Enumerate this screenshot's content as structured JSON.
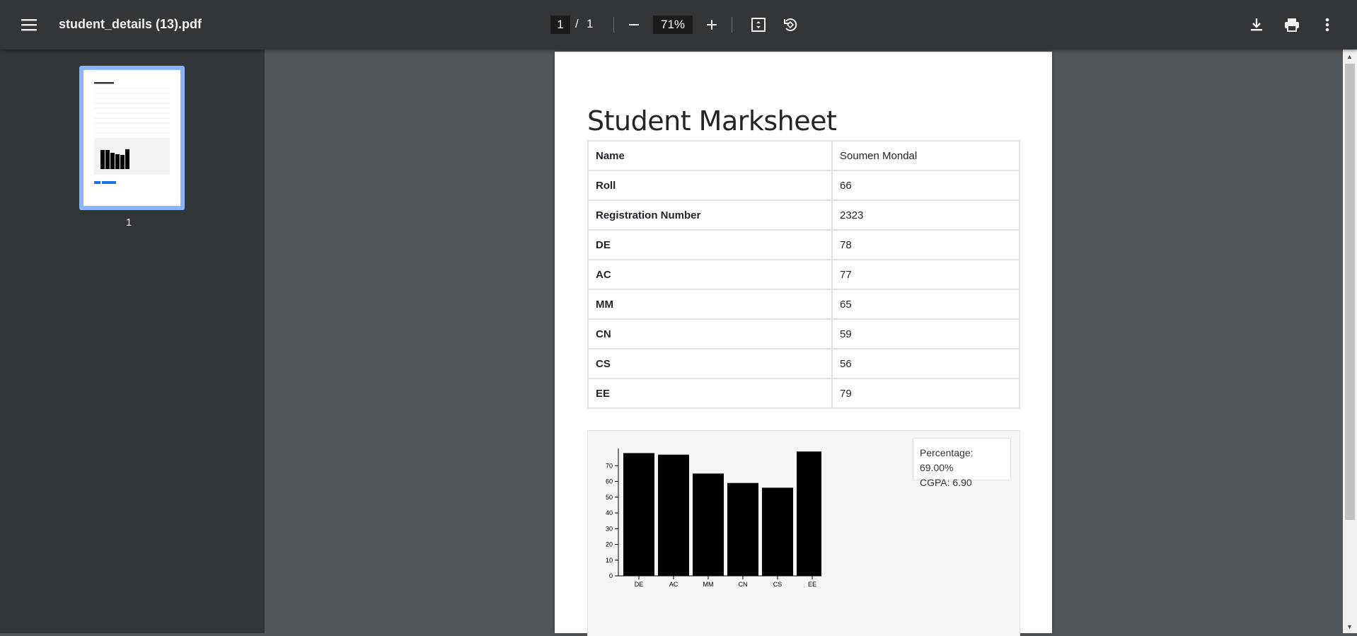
{
  "toolbar": {
    "menu_icon": "hamburger-menu-icon",
    "title": "student_details (13).pdf",
    "current_page": "1",
    "page_separator": "/",
    "total_pages": "1",
    "zoom": "71%",
    "icons": [
      "minus-icon",
      "plus-icon",
      "fit-page-icon",
      "rotate-icon",
      "download-icon",
      "print-icon",
      "more-vert-icon"
    ]
  },
  "sidebar": {
    "thumbnail_label": "1"
  },
  "document": {
    "heading": "Student Marksheet",
    "rows": [
      {
        "label": "Name",
        "value": "Soumen Mondal"
      },
      {
        "label": "Roll",
        "value": "66"
      },
      {
        "label": "Registration Number",
        "value": "2323"
      },
      {
        "label": "DE",
        "value": "78"
      },
      {
        "label": "AC",
        "value": "77"
      },
      {
        "label": "MM",
        "value": "65"
      },
      {
        "label": "CN",
        "value": "59"
      },
      {
        "label": "CS",
        "value": "56"
      },
      {
        "label": "EE",
        "value": "79"
      }
    ],
    "stats": {
      "percentage": "Percentage: 69.00%",
      "cgpa": "CGPA: 6.90"
    }
  },
  "chart_data": {
    "type": "bar",
    "categories": [
      "DE",
      "AC",
      "MM",
      "CN",
      "CS",
      "EE"
    ],
    "values": [
      78,
      77,
      65,
      59,
      56,
      79
    ],
    "yticks": [
      0,
      10,
      20,
      30,
      40,
      50,
      60,
      70
    ],
    "ylim": [
      0,
      80
    ],
    "bar_color": "#000000",
    "grid": false
  },
  "colors": {
    "toolbar_bg": "#323639",
    "viewer_bg": "#525659",
    "thumbnail_highlight": "#8ab4f8",
    "page_input_bg": "#191b1c"
  }
}
